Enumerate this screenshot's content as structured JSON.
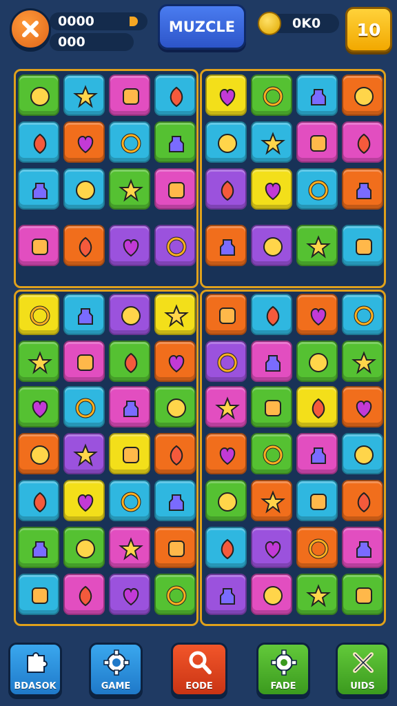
{
  "header": {
    "close_icon": "close-icon",
    "stat_primary": "0000",
    "stat_secondary": "000",
    "title": "MUZCLE",
    "coins": "0K0",
    "level": "10"
  },
  "colors": {
    "green": "#55c132",
    "pink": "#e24ec0",
    "cyan": "#2fb7e0",
    "orange": "#f16e1c",
    "purple": "#9b52dd",
    "yellow": "#f3df1a",
    "frame": "#e0a11b",
    "background": "#1f3a63"
  },
  "board": {
    "rows": [
      [
        "green",
        "cyan",
        "pink",
        "cyan",
        "yellow",
        "green",
        "cyan",
        "orange"
      ],
      [
        "cyan",
        "orange",
        "cyan",
        "green",
        "cyan",
        "cyan",
        "pink",
        "pink"
      ],
      [
        "cyan",
        "cyan",
        "green",
        "pink",
        "purple",
        "yellow",
        "cyan",
        "orange"
      ],
      [
        "pink",
        "orange",
        "purple",
        "purple",
        "orange",
        "purple",
        "green",
        "cyan"
      ],
      [
        "yellow",
        "cyan",
        "purple",
        "yellow",
        "orange",
        "cyan",
        "orange",
        "cyan"
      ],
      [
        "green",
        "pink",
        "green",
        "orange",
        "purple",
        "pink",
        "green",
        "green"
      ],
      [
        "green",
        "cyan",
        "pink",
        "green",
        "pink",
        "green",
        "yellow",
        "orange"
      ],
      [
        "orange",
        "purple",
        "yellow",
        "orange",
        "orange",
        "green",
        "pink",
        "cyan"
      ],
      [
        "cyan",
        "yellow",
        "cyan",
        "cyan",
        "green",
        "orange",
        "cyan",
        "orange"
      ],
      [
        "green",
        "green",
        "pink",
        "orange",
        "cyan",
        "purple",
        "orange",
        "pink"
      ],
      [
        "cyan",
        "pink",
        "purple",
        "green",
        "purple",
        "pink",
        "green",
        "green"
      ]
    ],
    "icons": [
      [
        "box-icon",
        "heart-icon",
        "cheese-icon",
        "vase-icon",
        "star-icon",
        "battery-icon",
        "gear-icon",
        "jug-icon"
      ],
      [
        "lantern-icon",
        "can-icon",
        "maple-leaf-icon",
        "boot-icon",
        "badge-icon",
        "ruler-icon",
        "bottle-icon",
        "mask-icon"
      ],
      [
        "flower-icon",
        "cube-icon",
        "acorn-icon",
        "ring-icon",
        "gem-icon",
        "star-icon",
        "lollipop-icon",
        "balloon-icon"
      ],
      [
        "balloon-icon",
        "leaf-icon",
        "bulb-icon",
        "wand-icon",
        "apple-icon",
        "eggplant-icon",
        "bulb-icon",
        "crystal-icon"
      ],
      [
        "lantern-icon",
        "brush-icon",
        "cup-icon",
        "virus-icon",
        "pot-icon",
        "drop-icon",
        "cauldron-icon",
        "bow-icon"
      ],
      [
        "star-icon",
        "starfish-icon",
        "lemon-icon",
        "star-icon",
        "eye-icon",
        "basket-icon",
        "fire-icon",
        "swirl-icon"
      ],
      [
        "swirl-icon",
        "apple-icon",
        "starfish-icon",
        "heart-icon",
        "hammer-icon",
        "moon-icon",
        "stone-icon",
        "frame-icon"
      ],
      [
        "battery-icon",
        "clip-icon",
        "ball-icon",
        "candy-icon",
        "star-icon",
        "ring-icon",
        "jar-icon",
        "crystal-icon"
      ],
      [
        "ring-icon",
        "pie-icon",
        "lollipop-icon",
        "kettle-icon",
        "orange-icon",
        "lantern-icon",
        "plant-icon",
        "mirror-icon"
      ],
      [
        "cheese-icon",
        "donut-icon",
        "bell-icon",
        "cookie-icon",
        "clock-icon",
        "bell-icon",
        "bottle-icon",
        "jar-icon"
      ],
      [
        "berry-icon",
        "drop-icon",
        "gear-icon",
        "ring-icon",
        "bucket-icon",
        "basket-icon",
        "cat-icon",
        "pear-icon"
      ]
    ]
  },
  "nav": [
    {
      "label": "BDASOK",
      "icon": "puzzle-icon"
    },
    {
      "label": "GAME",
      "icon": "gear-icon"
    },
    {
      "label": "EODE",
      "icon": "search-icon"
    },
    {
      "label": "FADE",
      "icon": "settings-icon"
    },
    {
      "label": "UIDS",
      "icon": "tools-icon"
    }
  ]
}
